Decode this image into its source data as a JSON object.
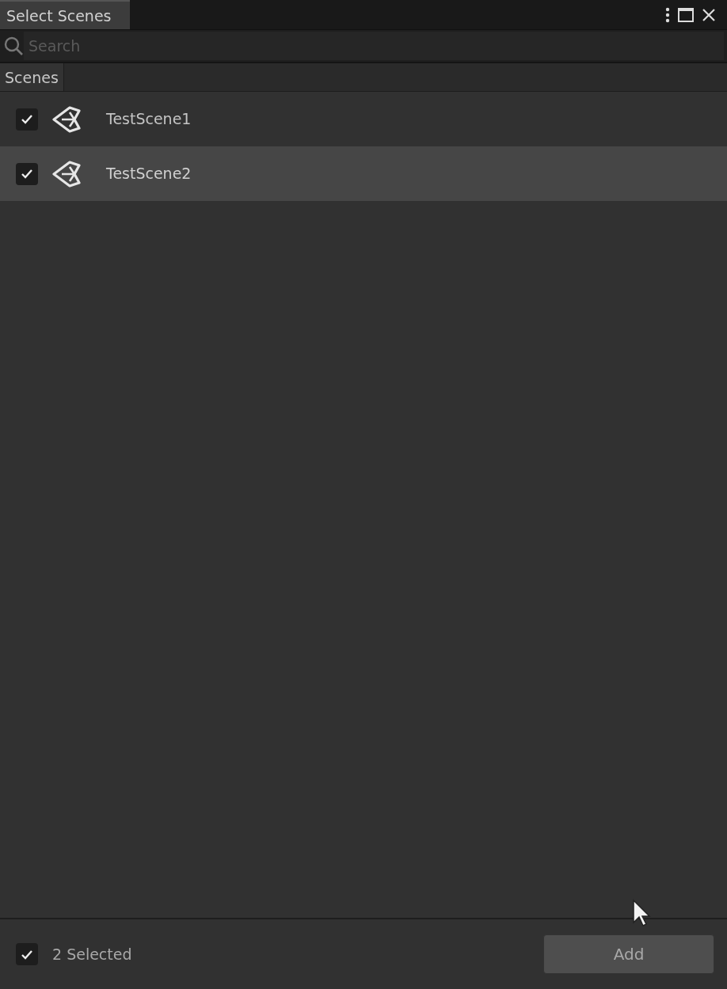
{
  "window": {
    "title": "Select Scenes"
  },
  "search": {
    "placeholder": "Search"
  },
  "list_header": "Scenes",
  "scenes": [
    {
      "name": "TestScene1",
      "checked": true,
      "selected": false
    },
    {
      "name": "TestScene2",
      "checked": true,
      "selected": true
    }
  ],
  "footer": {
    "select_all_checked": true,
    "count": "2 Selected",
    "button": "Add"
  }
}
